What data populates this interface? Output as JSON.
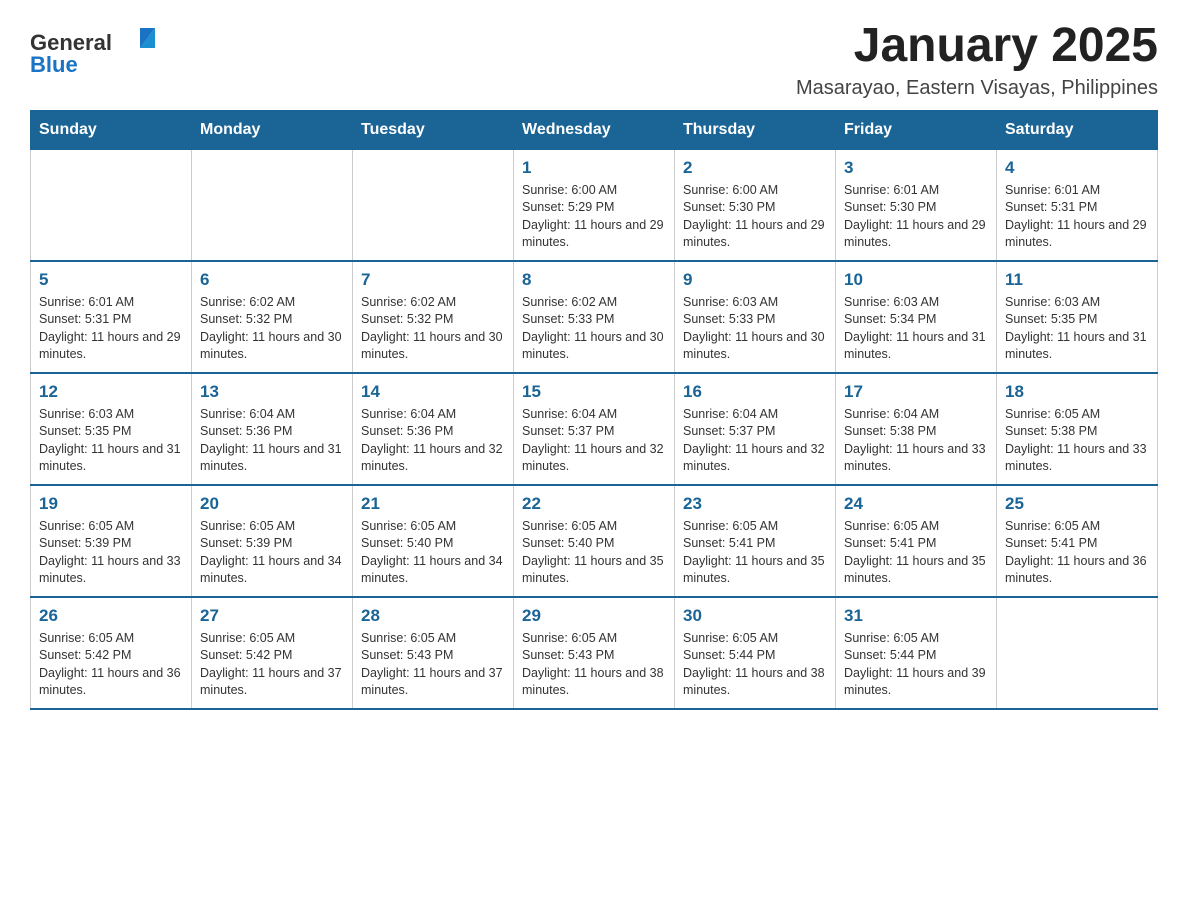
{
  "header": {
    "logo_general": "General",
    "logo_blue": "Blue",
    "month_year": "January 2025",
    "location": "Masarayao, Eastern Visayas, Philippines"
  },
  "calendar": {
    "days_of_week": [
      "Sunday",
      "Monday",
      "Tuesday",
      "Wednesday",
      "Thursday",
      "Friday",
      "Saturday"
    ],
    "weeks": [
      [
        {
          "day": "",
          "info": ""
        },
        {
          "day": "",
          "info": ""
        },
        {
          "day": "",
          "info": ""
        },
        {
          "day": "1",
          "info": "Sunrise: 6:00 AM\nSunset: 5:29 PM\nDaylight: 11 hours and 29 minutes."
        },
        {
          "day": "2",
          "info": "Sunrise: 6:00 AM\nSunset: 5:30 PM\nDaylight: 11 hours and 29 minutes."
        },
        {
          "day": "3",
          "info": "Sunrise: 6:01 AM\nSunset: 5:30 PM\nDaylight: 11 hours and 29 minutes."
        },
        {
          "day": "4",
          "info": "Sunrise: 6:01 AM\nSunset: 5:31 PM\nDaylight: 11 hours and 29 minutes."
        }
      ],
      [
        {
          "day": "5",
          "info": "Sunrise: 6:01 AM\nSunset: 5:31 PM\nDaylight: 11 hours and 29 minutes."
        },
        {
          "day": "6",
          "info": "Sunrise: 6:02 AM\nSunset: 5:32 PM\nDaylight: 11 hours and 30 minutes."
        },
        {
          "day": "7",
          "info": "Sunrise: 6:02 AM\nSunset: 5:32 PM\nDaylight: 11 hours and 30 minutes."
        },
        {
          "day": "8",
          "info": "Sunrise: 6:02 AM\nSunset: 5:33 PM\nDaylight: 11 hours and 30 minutes."
        },
        {
          "day": "9",
          "info": "Sunrise: 6:03 AM\nSunset: 5:33 PM\nDaylight: 11 hours and 30 minutes."
        },
        {
          "day": "10",
          "info": "Sunrise: 6:03 AM\nSunset: 5:34 PM\nDaylight: 11 hours and 31 minutes."
        },
        {
          "day": "11",
          "info": "Sunrise: 6:03 AM\nSunset: 5:35 PM\nDaylight: 11 hours and 31 minutes."
        }
      ],
      [
        {
          "day": "12",
          "info": "Sunrise: 6:03 AM\nSunset: 5:35 PM\nDaylight: 11 hours and 31 minutes."
        },
        {
          "day": "13",
          "info": "Sunrise: 6:04 AM\nSunset: 5:36 PM\nDaylight: 11 hours and 31 minutes."
        },
        {
          "day": "14",
          "info": "Sunrise: 6:04 AM\nSunset: 5:36 PM\nDaylight: 11 hours and 32 minutes."
        },
        {
          "day": "15",
          "info": "Sunrise: 6:04 AM\nSunset: 5:37 PM\nDaylight: 11 hours and 32 minutes."
        },
        {
          "day": "16",
          "info": "Sunrise: 6:04 AM\nSunset: 5:37 PM\nDaylight: 11 hours and 32 minutes."
        },
        {
          "day": "17",
          "info": "Sunrise: 6:04 AM\nSunset: 5:38 PM\nDaylight: 11 hours and 33 minutes."
        },
        {
          "day": "18",
          "info": "Sunrise: 6:05 AM\nSunset: 5:38 PM\nDaylight: 11 hours and 33 minutes."
        }
      ],
      [
        {
          "day": "19",
          "info": "Sunrise: 6:05 AM\nSunset: 5:39 PM\nDaylight: 11 hours and 33 minutes."
        },
        {
          "day": "20",
          "info": "Sunrise: 6:05 AM\nSunset: 5:39 PM\nDaylight: 11 hours and 34 minutes."
        },
        {
          "day": "21",
          "info": "Sunrise: 6:05 AM\nSunset: 5:40 PM\nDaylight: 11 hours and 34 minutes."
        },
        {
          "day": "22",
          "info": "Sunrise: 6:05 AM\nSunset: 5:40 PM\nDaylight: 11 hours and 35 minutes."
        },
        {
          "day": "23",
          "info": "Sunrise: 6:05 AM\nSunset: 5:41 PM\nDaylight: 11 hours and 35 minutes."
        },
        {
          "day": "24",
          "info": "Sunrise: 6:05 AM\nSunset: 5:41 PM\nDaylight: 11 hours and 35 minutes."
        },
        {
          "day": "25",
          "info": "Sunrise: 6:05 AM\nSunset: 5:41 PM\nDaylight: 11 hours and 36 minutes."
        }
      ],
      [
        {
          "day": "26",
          "info": "Sunrise: 6:05 AM\nSunset: 5:42 PM\nDaylight: 11 hours and 36 minutes."
        },
        {
          "day": "27",
          "info": "Sunrise: 6:05 AM\nSunset: 5:42 PM\nDaylight: 11 hours and 37 minutes."
        },
        {
          "day": "28",
          "info": "Sunrise: 6:05 AM\nSunset: 5:43 PM\nDaylight: 11 hours and 37 minutes."
        },
        {
          "day": "29",
          "info": "Sunrise: 6:05 AM\nSunset: 5:43 PM\nDaylight: 11 hours and 38 minutes."
        },
        {
          "day": "30",
          "info": "Sunrise: 6:05 AM\nSunset: 5:44 PM\nDaylight: 11 hours and 38 minutes."
        },
        {
          "day": "31",
          "info": "Sunrise: 6:05 AM\nSunset: 5:44 PM\nDaylight: 11 hours and 39 minutes."
        },
        {
          "day": "",
          "info": ""
        }
      ]
    ]
  }
}
